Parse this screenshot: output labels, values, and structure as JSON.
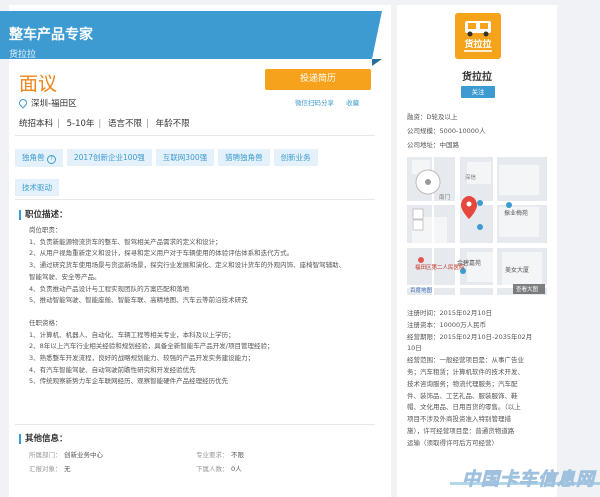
{
  "header": {
    "title": "整车产品专家",
    "company": "货拉拉"
  },
  "job": {
    "title": "面议",
    "apply_label": "投递简历",
    "location": "深圳-福田区",
    "links": [
      "微信扫码分享",
      "收藏"
    ],
    "requirements": [
      "统招本科",
      "5-10年",
      "语言不限",
      "年龄不限"
    ],
    "tags": [
      "独角兽",
      "2017创新企业100强",
      "互联网300强",
      "猎聘独角兽",
      "创新业务",
      "技术驱动"
    ]
  },
  "description": {
    "heading": "职位描述：",
    "lines": [
      "岗位职责：",
      "1、负责新能源物流货车的整车、智驾相关产品需求的定义和设计；",
      "2、从用户视角重新定义和设计，探寻和定义用户对于车辆使用的体验评估体系和迭代方式。",
      "3、通过研究货车使用场景与货运新场景，探究行业发展和演化、定义和设计货车的外观内饰、座椅智驾辅助、",
      "智能驾驶、安全等产品。",
      "4、负责推动产品设计与工程实现团队的方案匹配和落地",
      "5、推动智能驾驶、智能座舱、智能车联、高精地图、汽车云等前沿技术研究",
      "",
      "任职资格：",
      "1、计算机、机器人、自动化、车辆工程等相关专业，本科及以上学历；",
      "2、8年以上汽车行业相关经验和规划经验，具备全新智能车产品开发/项目管理经验；",
      "3、熟悉整车开发流程，良好的战略规划能力、较强的产品开发实务建设能力；",
      "4、有汽车智能驾驶、自动驾驶前瞻性研究和开发经验优先",
      "5、传统观察新势力车企车联网经历、观察智能硬件产品经理经历优先"
    ]
  },
  "other": {
    "heading": "其他信息：",
    "rows": [
      {
        "label": "所属部门：",
        "value": "创新业务中心",
        "label2": "专业要求：",
        "value2": "不限"
      },
      {
        "label": "汇报对象：",
        "value": "无",
        "label2": "下属人数：",
        "value2": "0人"
      }
    ]
  },
  "company": {
    "name": "货拉拉",
    "logo_text": "货拉拉",
    "follow_label": "关注",
    "info": [
      "融资：D轮及以上",
      "公司规模：5000-10000人",
      "公司地址：中国路"
    ],
    "map_labels": {
      "zhenye": "振业梅苑",
      "jinyu": "金碧嘉苑",
      "mei": "美女大厦",
      "futian": "福田区第二人民医院",
      "baidu": "百度地图",
      "detail_map": "查看大图",
      "shenxin": "深信",
      "nanmen": "南门"
    },
    "details": [
      "注册时间：2015年02月10日",
      "注册资本：10000万人民币",
      "经营期限：2015年02月10日-2035年02月",
      "10日",
      "经营范围：一般经营项目是：从事广告业",
      "务；汽车租赁；计算机软件的技术开发、",
      "技术咨询服务；物流代理服务；汽车配",
      "件、装饰品、工艺礼品、服装服饰、鞋",
      "帽、文化用品、日用百货的零售。（以上",
      "项目不涉及外商投资准入特别管理措",
      "施），许可经营项目是：普通货物道路",
      "运输（须取得许可后方可经营）"
    ]
  },
  "watermark": "中国卡车信息网",
  "colors": {
    "brand_blue": "#3d9bd1",
    "salary_orange": "#f08519",
    "apply_orange": "#f6a21c"
  }
}
